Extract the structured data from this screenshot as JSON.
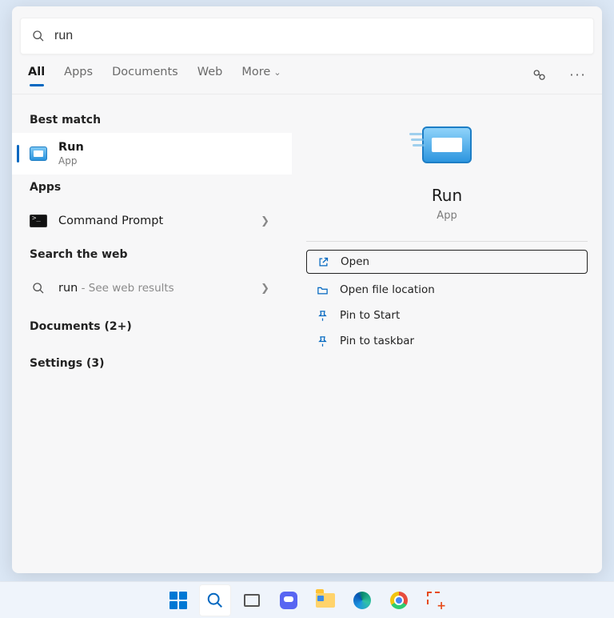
{
  "search": {
    "value": "run"
  },
  "tabs": {
    "all": "All",
    "apps": "Apps",
    "documents": "Documents",
    "web": "Web",
    "more": "More"
  },
  "sections": {
    "best_match": "Best match",
    "apps": "Apps",
    "search_web": "Search the web",
    "documents": "Documents (2+)",
    "settings": "Settings (3)"
  },
  "results": {
    "run": {
      "title": "Run",
      "subtitle": "App"
    },
    "cmd": {
      "title": "Command Prompt"
    },
    "web_run": {
      "prefix": "run",
      "suffix": " - See web results"
    }
  },
  "detail": {
    "title": "Run",
    "subtitle": "App",
    "actions": {
      "open": "Open",
      "open_location": "Open file location",
      "pin_start": "Pin to Start",
      "pin_taskbar": "Pin to taskbar"
    }
  }
}
